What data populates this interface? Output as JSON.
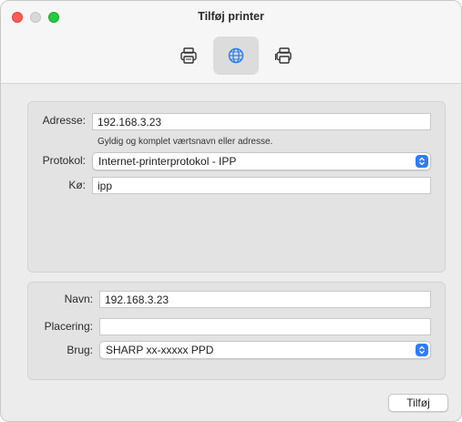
{
  "window": {
    "title": "Tilføj printer"
  },
  "toolbar": {
    "icons": [
      "printer-icon",
      "globe-icon",
      "printer-fax-icon"
    ],
    "selected": 1
  },
  "network": {
    "address_label": "Adresse:",
    "address_value": "192.168.3.23",
    "address_hint": "Gyldig og komplet værtsnavn eller adresse.",
    "protocol_label": "Protokol:",
    "protocol_value": "Internet-printerprotokol - IPP",
    "queue_label": "Kø:",
    "queue_value": "ipp"
  },
  "details": {
    "name_label": "Navn:",
    "name_value": "192.168.3.23",
    "location_label": "Placering:",
    "location_value": "",
    "use_label": "Brug:",
    "use_value": "SHARP xx-xxxxx PPD"
  },
  "actions": {
    "add_label": "Tilføj"
  },
  "colors": {
    "accent": "#2f7cf6",
    "close": "#ff5f57",
    "maximize": "#28c840"
  }
}
